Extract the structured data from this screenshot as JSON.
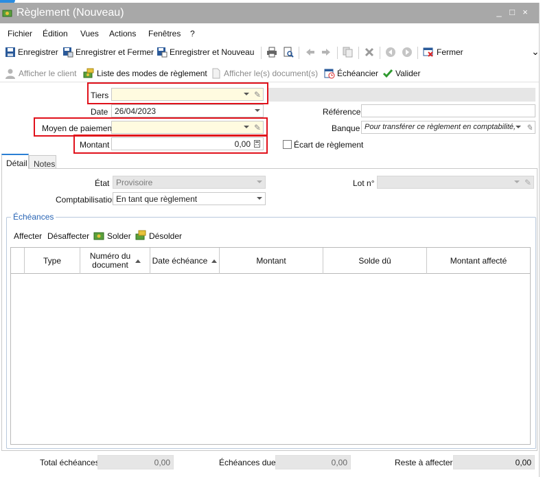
{
  "window": {
    "title": "Règlement (Nouveau)",
    "controls": [
      "_",
      "□",
      "×"
    ]
  },
  "menu": [
    "Fichier",
    "Édition",
    "Vues",
    "Actions",
    "Fenêtres",
    "?"
  ],
  "toolbar": {
    "save": "Enregistrer",
    "save_close": "Enregistrer et Fermer",
    "save_new": "Enregistrer et Nouveau",
    "close": "Fermer",
    "more": "⌄"
  },
  "toolbar2": {
    "show_client": "Afficher le client",
    "payment_modes": "Liste des modes de règlement",
    "show_documents": "Afficher le(s) document(s)",
    "schedule": "Échéancier",
    "validate": "Valider"
  },
  "form": {
    "tiers_label": "Tiers",
    "tiers_value": "",
    "date_label": "Date",
    "date_value": "26/04/2023",
    "reference_label": "Référence",
    "reference_value": "",
    "payment_method_label": "Moyen de paiement",
    "payment_method_value": "",
    "bank_label": "Banque",
    "bank_value": "Pour transférer ce règlement en comptabilité,",
    "amount_label": "Montant",
    "amount_value": "0,00",
    "gap_label": "Écart de règlement"
  },
  "tabs": [
    "Détail",
    "Notes"
  ],
  "detail": {
    "state_label": "État",
    "state_value": "Provisoire",
    "lot_label": "Lot n°",
    "lot_value": "",
    "accounting_label": "Comptabilisation",
    "accounting_value": "En tant que règlement"
  },
  "echeances": {
    "group_label": "Échéances",
    "actions": [
      "Affecter",
      "Désaffecter",
      "Solder",
      "Désolder"
    ],
    "columns": [
      "",
      "Type",
      "Numéro du document",
      "Date échéance",
      "Montant",
      "Solde dû",
      "Montant affecté"
    ],
    "rows": []
  },
  "footer": {
    "total_label": "Total échéances",
    "total_value": "0,00",
    "due_label": "Échéances dues",
    "due_value": "0,00",
    "remaining_label": "Reste à affecter",
    "remaining_value": "0,00"
  },
  "colors": {
    "highlight_border": "#e0101a",
    "required_field_bg": "#fffbe0",
    "group_title": "#2864b4",
    "titlebar": "#a8a8a8"
  }
}
